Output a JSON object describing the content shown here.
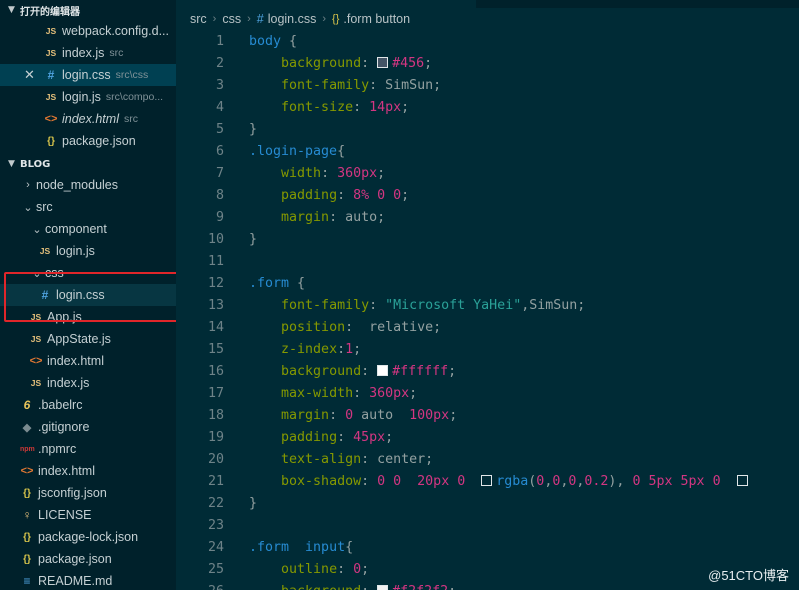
{
  "sidebar": {
    "open_editors": {
      "title": "打开的编辑器",
      "items": [
        {
          "icon": "JS",
          "name": "webpack.config.d...",
          "desc": ""
        },
        {
          "icon": "JS",
          "name": "index.js",
          "desc": "src"
        },
        {
          "icon": "#",
          "name": "login.css",
          "desc": "src\\css"
        },
        {
          "icon": "JS",
          "name": "login.js",
          "desc": "src\\compo..."
        },
        {
          "icon": "<>",
          "name": "index.html",
          "desc": "src"
        },
        {
          "icon": "{}",
          "name": "package.json",
          "desc": ""
        }
      ]
    },
    "explorer": {
      "title": "BLOG",
      "items": [
        {
          "name": "node_modules"
        },
        {
          "name": "src"
        },
        {
          "name": "component"
        },
        {
          "name": "login.js"
        },
        {
          "name": "css"
        },
        {
          "name": "login.css"
        },
        {
          "name": "App.js"
        },
        {
          "name": "AppState.js"
        },
        {
          "name": "index.html"
        },
        {
          "name": "index.js"
        },
        {
          "name": ".babelrc"
        },
        {
          "name": ".gitignore"
        },
        {
          "name": ".npmrc"
        },
        {
          "name": "index.html"
        },
        {
          "name": "jsconfig.json"
        },
        {
          "name": "LICENSE"
        },
        {
          "name": "package-lock.json"
        },
        {
          "name": "package.json"
        },
        {
          "name": "README.md"
        }
      ]
    }
  },
  "breadcrumb": {
    "parts": [
      "src",
      "css",
      "login.css",
      ".form button"
    ],
    "css_icon": "#",
    "symbol_icon": "{}"
  },
  "editor": {
    "line_numbers": [
      "1",
      "2",
      "3",
      "4",
      "5",
      "6",
      "7",
      "8",
      "9",
      "10",
      "11",
      "12",
      "13",
      "14",
      "15",
      "16",
      "17",
      "18",
      "19",
      "20",
      "21",
      "22",
      "23",
      "24",
      "25",
      "26"
    ]
  },
  "colors": {
    "selector": "#268bd2",
    "property": "#859900",
    "number": "#d33682",
    "string": "#2aa198",
    "highlight": "#e0262a"
  },
  "watermark": "@51CTO博客"
}
